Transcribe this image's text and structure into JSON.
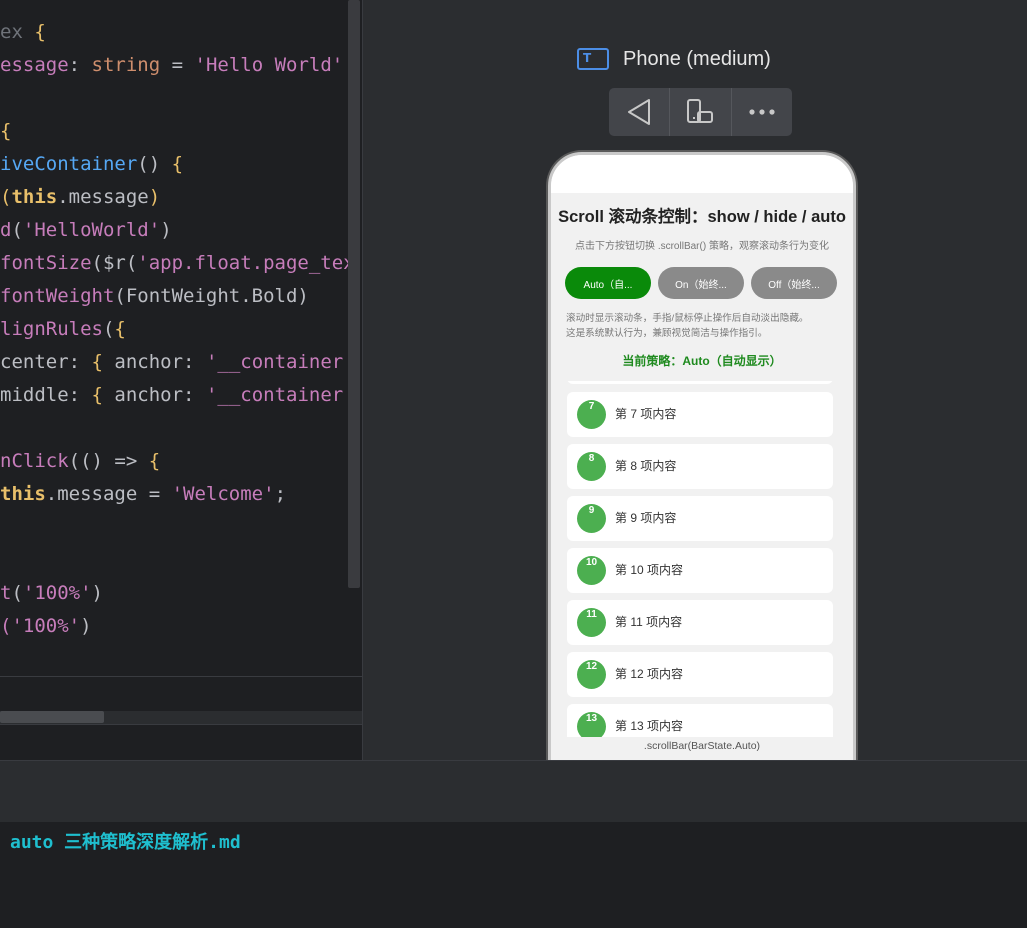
{
  "editor": {
    "lines": [
      [
        [
          "ex ",
          "gray"
        ],
        [
          "{",
          "brace"
        ]
      ],
      [
        [
          "essage",
          "prop"
        ],
        [
          ": ",
          "op"
        ],
        [
          "string",
          "type"
        ],
        [
          " = ",
          "op"
        ],
        [
          "'Hello World'",
          "str"
        ]
      ],
      [],
      [
        [
          "{",
          "brace"
        ]
      ],
      [
        [
          "iveContainer",
          "fn"
        ],
        [
          "() ",
          "op"
        ],
        [
          "{",
          "brace"
        ]
      ],
      [
        [
          "(",
          "brace"
        ],
        [
          "this",
          "this"
        ],
        [
          ".message",
          "op"
        ],
        [
          ")",
          "brace"
        ]
      ],
      [
        [
          "d",
          "call"
        ],
        [
          "(",
          "op"
        ],
        [
          "'HelloWorld'",
          "str"
        ],
        [
          ")",
          "op"
        ]
      ],
      [
        [
          "fontSize",
          "call"
        ],
        [
          "($r(",
          "op"
        ],
        [
          "'app.float.page_tex",
          "str"
        ]
      ],
      [
        [
          "fontWeight",
          "call"
        ],
        [
          "(FontWeight.Bold)",
          "op"
        ]
      ],
      [
        [
          "lignRules",
          "call"
        ],
        [
          "(",
          "op"
        ],
        [
          "{",
          "brace"
        ]
      ],
      [
        [
          "center",
          "op"
        ],
        [
          ": ",
          "op"
        ],
        [
          "{",
          "brace"
        ],
        [
          " anchor: ",
          "op"
        ],
        [
          "'__container",
          "str"
        ]
      ],
      [
        [
          "middle",
          "op"
        ],
        [
          ": ",
          "op"
        ],
        [
          "{",
          "brace"
        ],
        [
          " anchor: ",
          "op"
        ],
        [
          "'__container",
          "str"
        ]
      ],
      [],
      [
        [
          "nClick",
          "call"
        ],
        [
          "(() => ",
          "op"
        ],
        [
          "{",
          "brace"
        ]
      ],
      [
        [
          "this",
          "this"
        ],
        [
          ".message = ",
          "op"
        ],
        [
          "'Welcome'",
          "str"
        ],
        [
          ";",
          "op"
        ]
      ],
      [],
      [],
      [
        [
          "t",
          "call"
        ],
        [
          "(",
          "op"
        ],
        [
          "'100%'",
          "str"
        ],
        [
          ")",
          "op"
        ]
      ],
      [
        [
          "(",
          "call"
        ],
        [
          "'100%'",
          "str"
        ],
        [
          ")",
          "op"
        ]
      ]
    ]
  },
  "previewer": {
    "device_name": "Phone (medium)",
    "device_icon": "tablet-icon"
  },
  "app": {
    "title": "Scroll 滚动条控制：show / hide / auto",
    "description": "点击下方按钮切换 .scrollBar() 策略，观察滚动条行为变化",
    "buttons": [
      {
        "label": "Auto（自...",
        "color": "#0a8a0a"
      },
      {
        "label": "On（始终...",
        "color": "#8a8a8a"
      },
      {
        "label": "Off（始终...",
        "color": "#8a8a8a"
      }
    ],
    "note_line1": "滚动时显示滚动条，手指/鼠标停止操作后自动淡出隐藏。",
    "note_line2": "这是系统默认行为，兼顾视觉简洁与操作指引。",
    "current_strategy": "当前策略：Auto（自动显示）",
    "items": [
      {
        "num": "7",
        "text": "第 7 项内容"
      },
      {
        "num": "8",
        "text": "第 8 项内容"
      },
      {
        "num": "9",
        "text": "第 9 项内容"
      },
      {
        "num": "10",
        "text": "第 10 项内容"
      },
      {
        "num": "11",
        "text": "第 11 项内容"
      },
      {
        "num": "12",
        "text": "第 12 项内容"
      },
      {
        "num": "13",
        "text": "第 13 项内容"
      }
    ],
    "footer": ".scrollBar(BarState.Auto)"
  },
  "terminal": {
    "text": "auto 三种策略深度解析.md"
  }
}
